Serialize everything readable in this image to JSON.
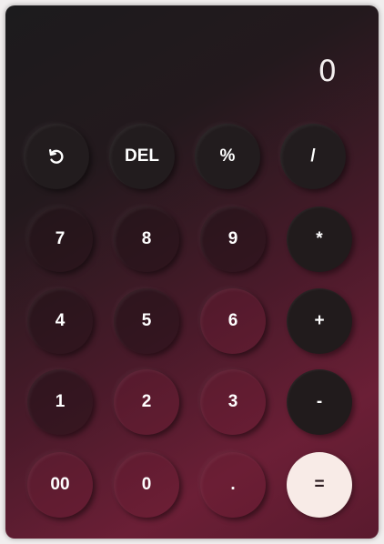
{
  "display": {
    "value": "0"
  },
  "keys": {
    "reset_icon": "rotate-ccw-icon",
    "del": "DEL",
    "percent": "%",
    "divide": "/",
    "seven": "7",
    "eight": "8",
    "nine": "9",
    "multiply": "*",
    "four": "4",
    "five": "5",
    "six": "6",
    "plus": "+",
    "one": "1",
    "two": "2",
    "three": "3",
    "minus": "-",
    "double_zero": "00",
    "zero": "0",
    "dot": ".",
    "equals": "="
  },
  "colors": {
    "gradient_start": "#1c1b1d",
    "gradient_end": "#6b1f36",
    "operator_key": "#211b1c",
    "equals_key": "#f8ebe7",
    "text": "#ffffff"
  }
}
